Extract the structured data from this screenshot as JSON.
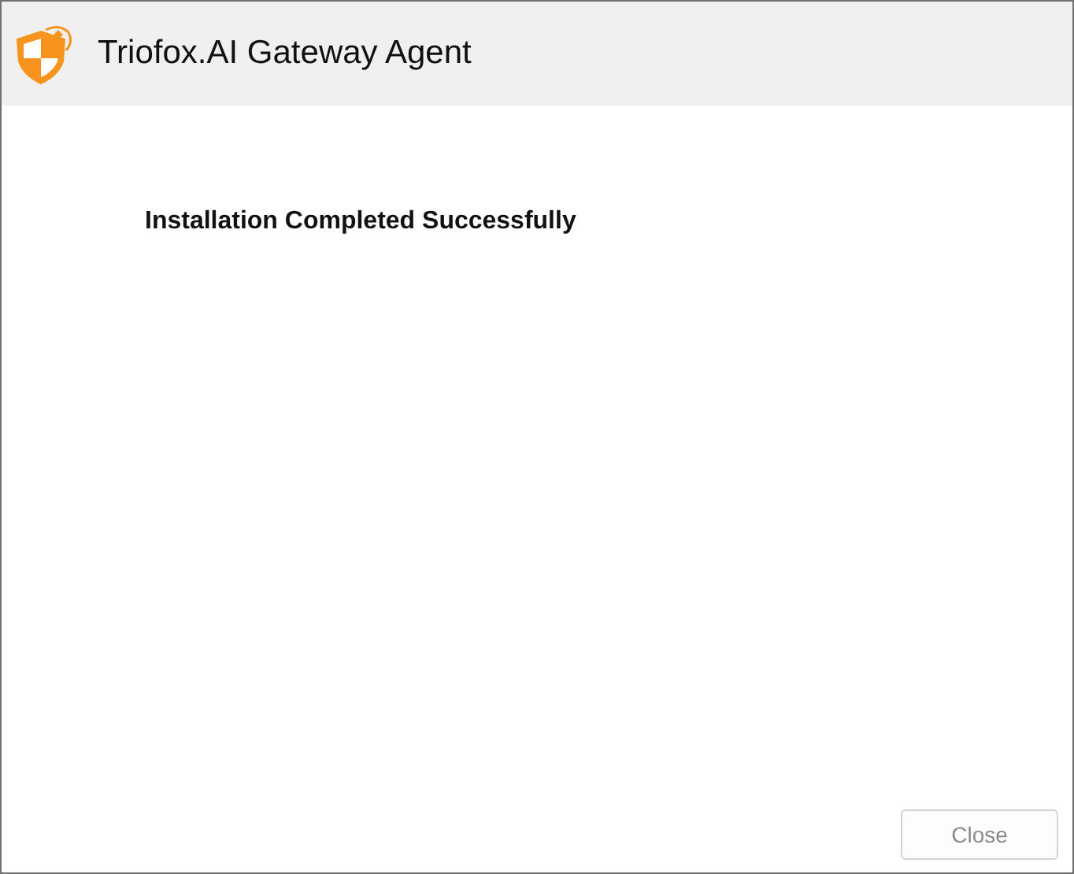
{
  "window": {
    "title": "Triofox.AI Gateway Agent"
  },
  "message": "Installation Completed Successfully",
  "buttons": [
    {
      "label": "Close",
      "disabled": true
    }
  ]
}
